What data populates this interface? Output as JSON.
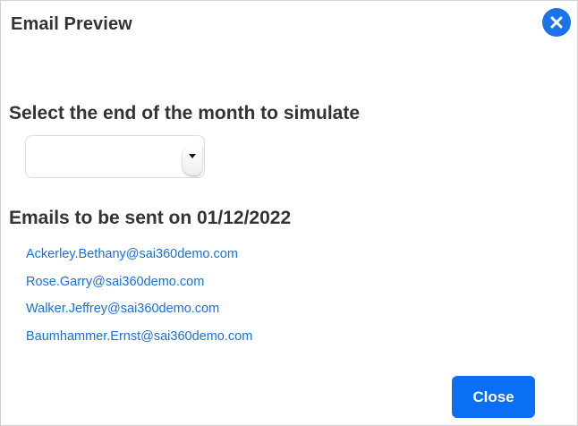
{
  "dialog": {
    "title": "Email Preview",
    "close_icon": "close-circle-icon"
  },
  "month_section": {
    "label": "Select the end of the month to simulate",
    "select_value": "",
    "dropdown_icon": "chevron-down-icon"
  },
  "emails_section": {
    "label": "Emails to be sent on 01/12/2022",
    "emails": [
      "Ackerley.Bethany@sai360demo.com",
      "Rose.Garry@sai360demo.com",
      "Walker.Jeffrey@sai360demo.com",
      "Baumhammer.Ernst@sai360demo.com"
    ]
  },
  "footer": {
    "close_label": "Close"
  },
  "colors": {
    "accent": "#1a73e8",
    "link": "#1a6fd8",
    "button": "#0b6ff5",
    "heading": "#333333"
  }
}
